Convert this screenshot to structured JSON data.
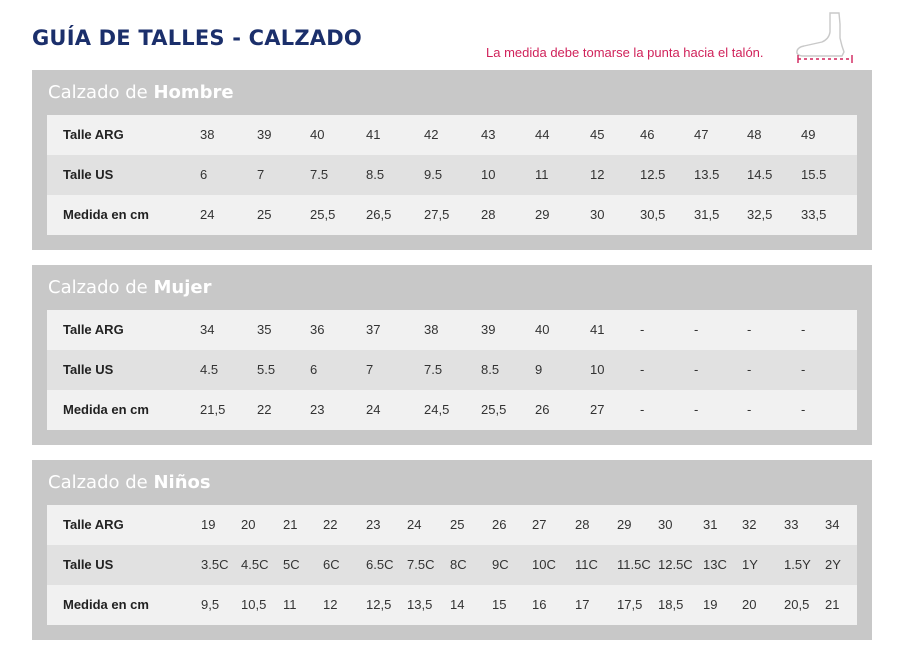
{
  "header": {
    "title": "GUÍA DE TALLES - CALZADO",
    "note": "La medida debe tomarse la punta hacia el talón.",
    "icon": "foot-measure-icon"
  },
  "sections": [
    {
      "title_prefix": "Calzado de",
      "title_bold": "Hombre",
      "rows": [
        {
          "label": "Talle ARG",
          "values": [
            "38",
            "39",
            "40",
            "41",
            "42",
            "43",
            "44",
            "45",
            "46",
            "47",
            "48",
            "49"
          ]
        },
        {
          "label": "Talle US",
          "values": [
            "6",
            "7",
            "7.5",
            "8.5",
            "9.5",
            "10",
            "11",
            "12",
            "12.5",
            "13.5",
            "14.5",
            "15.5"
          ]
        },
        {
          "label": "Medida en cm",
          "values": [
            "24",
            "25",
            "25,5",
            "26,5",
            "27,5",
            "28",
            "29",
            "30",
            "30,5",
            "31,5",
            "32,5",
            "33,5"
          ]
        }
      ]
    },
    {
      "title_prefix": "Calzado de",
      "title_bold": "Mujer",
      "rows": [
        {
          "label": "Talle ARG",
          "values": [
            "34",
            "35",
            "36",
            "37",
            "38",
            "39",
            "40",
            "41",
            "-",
            "-",
            "-",
            "-"
          ]
        },
        {
          "label": "Talle US",
          "values": [
            "4.5",
            "5.5",
            "6",
            "7",
            "7.5",
            "8.5",
            "9",
            "10",
            "-",
            "-",
            "-",
            "-"
          ]
        },
        {
          "label": "Medida en cm",
          "values": [
            "21,5",
            "22",
            "23",
            "24",
            "24,5",
            "25,5",
            "26",
            "27",
            "-",
            "-",
            "-",
            "-"
          ]
        }
      ]
    },
    {
      "title_prefix": "Calzado de",
      "title_bold": "Niños",
      "rows": [
        {
          "label": "Talle ARG",
          "values": [
            "19",
            "20",
            "21",
            "22",
            "23",
            "24",
            "25",
            "26",
            "27",
            "28",
            "29",
            "30",
            "31",
            "32",
            "33",
            "34"
          ]
        },
        {
          "label": "Talle US",
          "values": [
            "3.5C",
            "4.5C",
            "5C",
            "6C",
            "6.5C",
            "7.5C",
            "8C",
            "9C",
            "10C",
            "11C",
            "11.5C",
            "12.5C",
            "13C",
            "1Y",
            "1.5Y",
            "2Y"
          ]
        },
        {
          "label": "Medida en cm",
          "values": [
            "9,5",
            "10,5",
            "11",
            "12",
            "12,5",
            "13,5",
            "14",
            "15",
            "16",
            "17",
            "17,5",
            "18,5",
            "19",
            "20",
            "20,5",
            "21"
          ]
        }
      ]
    }
  ]
}
